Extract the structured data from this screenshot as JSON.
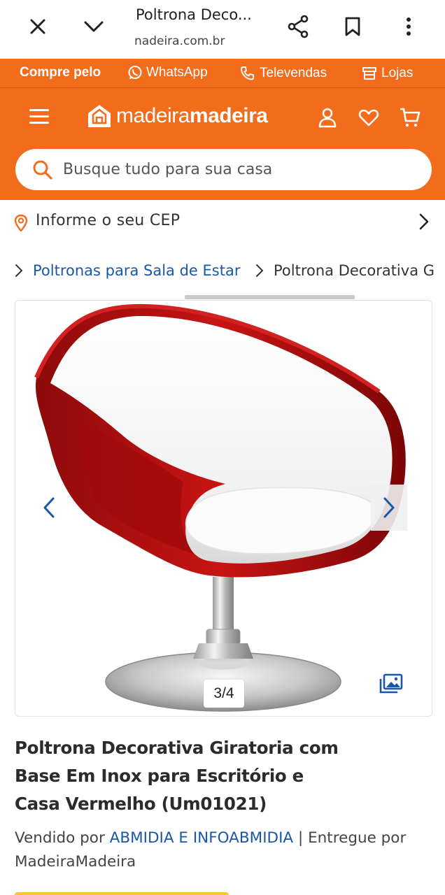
{
  "browser": {
    "title": "Poltrona Deco...",
    "url": "nadeira.com.br"
  },
  "promo_bar": {
    "label": "Compre pelo",
    "whatsapp": "WhatsApp",
    "televendas": "Televendas",
    "lojas": "Lojas"
  },
  "header": {
    "logo_light": "madeira",
    "logo_bold": "madeira"
  },
  "search": {
    "placeholder": "Busque tudo para sua casa"
  },
  "cep": {
    "label": "Informe o seu CEP"
  },
  "breadcrumb": {
    "category": "Poltronas para Sala de Estar",
    "current": "Poltrona Decorativa G"
  },
  "gallery": {
    "counter": "3/4",
    "current_index": 3,
    "total": 4
  },
  "product": {
    "title": "Poltrona Decorativa Giratoria com Base Em Inox para Escritório e Casa Vermelho (Um01021)",
    "sold_by_label": "Vendido por",
    "seller": "ABMIDIA E INFOABMIDIA",
    "separator": "|",
    "delivered_by_label": "Entregue por",
    "delivered_by": "MadeiraMadeira"
  },
  "colors": {
    "brand_orange": "#f26c1b",
    "link_blue": "#1b57a8",
    "chair_red": "#b3100f"
  }
}
